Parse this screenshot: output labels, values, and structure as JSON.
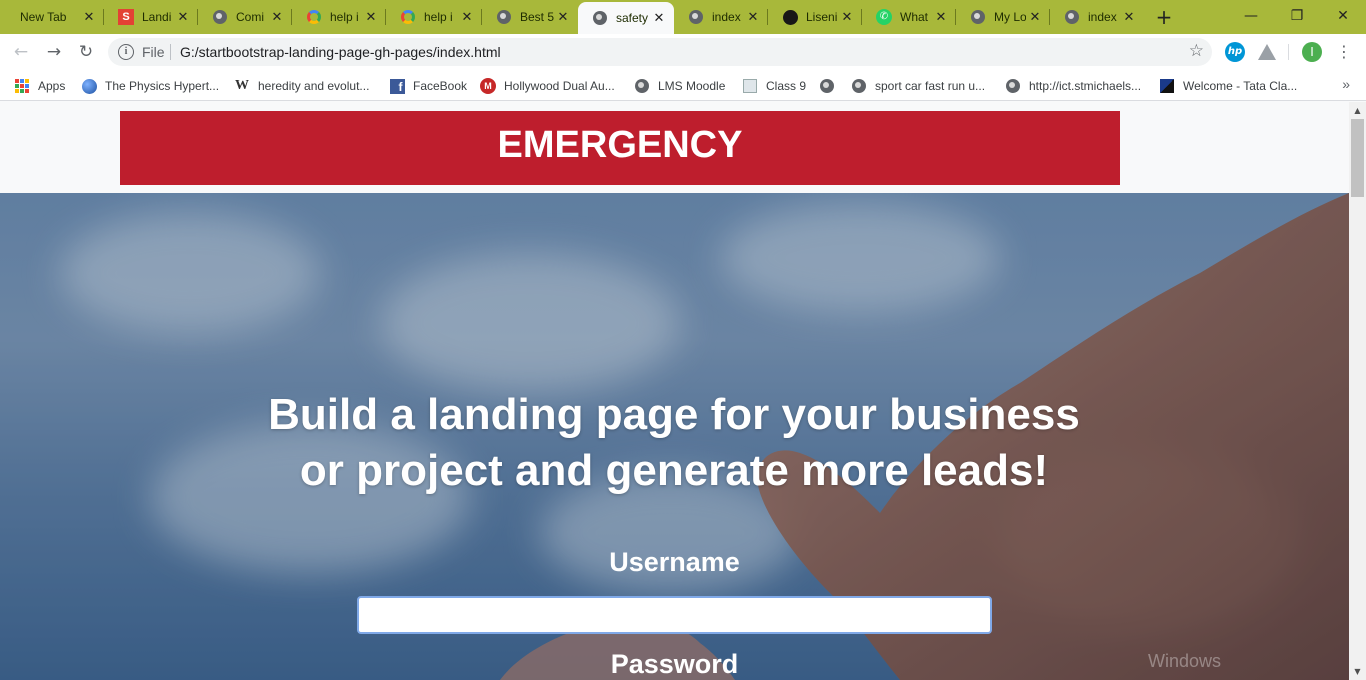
{
  "tabs": [
    {
      "title": "New Tab",
      "icon": "none"
    },
    {
      "title": "Landi",
      "icon": "s-icon"
    },
    {
      "title": "Comi",
      "icon": "globe-icon"
    },
    {
      "title": "help i",
      "icon": "google-icon"
    },
    {
      "title": "help i",
      "icon": "google-icon"
    },
    {
      "title": "Best 5",
      "icon": "globe-icon"
    },
    {
      "title": "safety",
      "icon": "globe-icon",
      "active": true
    },
    {
      "title": "index",
      "icon": "globe-icon"
    },
    {
      "title": "Liseni",
      "icon": "github-icon"
    },
    {
      "title": "What",
      "icon": "whatsapp-icon"
    },
    {
      "title": "My Lo",
      "icon": "globe-icon"
    },
    {
      "title": "index",
      "icon": "globe-icon"
    }
  ],
  "window_controls": {
    "minimize": "—",
    "restore": "❐",
    "close": "✕"
  },
  "toolbar": {
    "back": "←",
    "forward": "→",
    "reload": "↻",
    "file_label": "File",
    "url": "G:/startbootstrap-landing-page-gh-pages/index.html",
    "profile_initial": "I"
  },
  "bookmarks": [
    {
      "label": "Apps",
      "icon": "apps-grid-icon"
    },
    {
      "label": "The Physics Hypert...",
      "icon": "globe-icon"
    },
    {
      "label": "heredity and evolut...",
      "icon": "w-icon"
    },
    {
      "label": "FaceBook",
      "icon": "facebook-icon"
    },
    {
      "label": "Hollywood Dual Au...",
      "icon": "m-icon"
    },
    {
      "label": "LMS Moodle",
      "icon": "globe-icon"
    },
    {
      "label": "Class 9",
      "icon": "class-icon"
    },
    {
      "label": "",
      "icon": "globe-icon"
    },
    {
      "label": "sport car fast run u...",
      "icon": "globe-icon"
    },
    {
      "label": "http://ict.stmichaels...",
      "icon": "globe-icon"
    },
    {
      "label": "Welcome - Tata Cla...",
      "icon": "tata-icon"
    }
  ],
  "page": {
    "banner": "EMERGENCY",
    "headline_line1": "Build a landing page for your business",
    "headline_line2": "or project and generate more leads!",
    "username_label": "Username",
    "username_value": "",
    "password_label": "Password",
    "watermark": "Windows"
  },
  "colors": {
    "tabstrip": "#a8b83a",
    "banner": "#be1e2d",
    "profile": "#4caf50"
  }
}
